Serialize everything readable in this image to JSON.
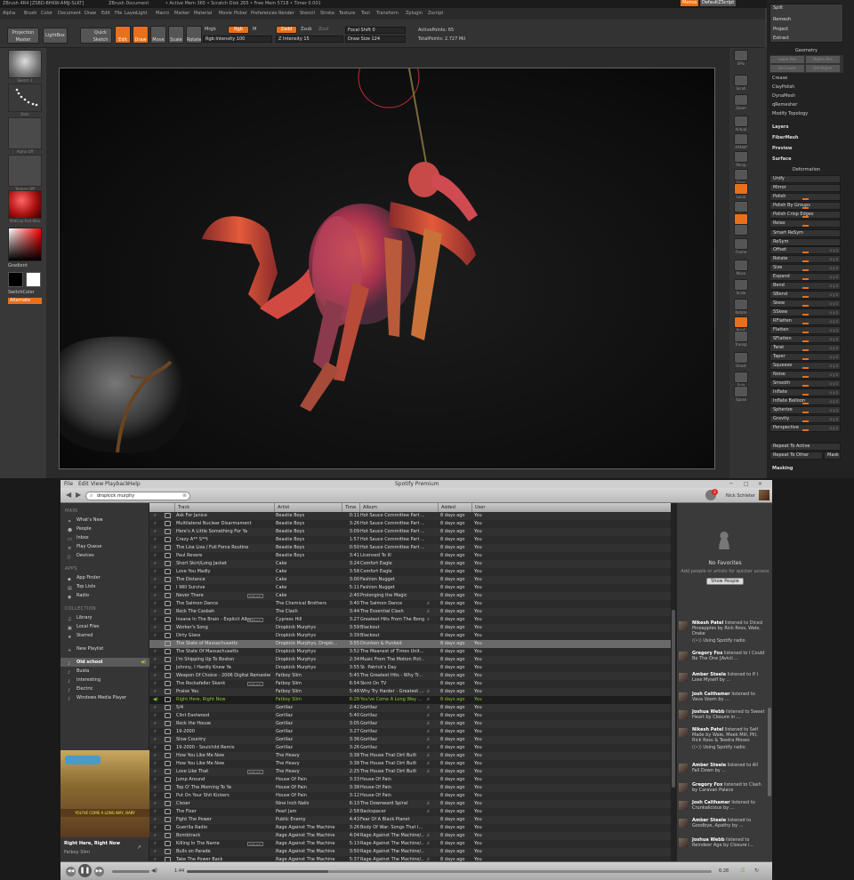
{
  "zbrush": {
    "title_left": "ZBrush 4R4 [ZSBD-BHKW-AMJJ-SLKT]",
    "title_doc": "ZBrush Document",
    "title_stats": "• Active Mem 365 • Scratch Disk 265 • Free Mem 5718 • Timer 0.001",
    "menus_button": "Menus",
    "default_script": "DefaultZScript",
    "menu": [
      "Alpha",
      "Brush",
      "Color",
      "Document",
      "Draw",
      "Edit",
      "File",
      "Layer",
      "Light",
      "Macro",
      "Marker",
      "Material",
      "Movie",
      "Picker",
      "Preferences",
      "Render",
      "Stencil",
      "Stroke",
      "Texture",
      "Tool",
      "Transform",
      "Zplugin",
      "Zscript"
    ],
    "toolbar": {
      "projection_master": "Projection Master",
      "lightbox": "LightBox",
      "quick_sketch": "Quick Sketch",
      "edit": "Edit",
      "draw": "Draw",
      "move": "Move",
      "scale": "Scale",
      "rotate": "Rotate",
      "mrgb": "Mrgb",
      "rgb": "Rgb",
      "m": "M",
      "rgb_intensity": "Rgb Intensity 100",
      "zadd": "Zadd",
      "zsub": "Zsub",
      "zcut": "Zcut",
      "z_intensity": "Z Intensity 15",
      "focal_shift": "Focal Shift 0",
      "draw_size": "Draw Size 124",
      "active_points": "ActivePoints: 65",
      "total_points": "TotalPoints: 2.727 Mil"
    },
    "left": {
      "tile1_label": "Sketch 1",
      "tile2_label": "Dots",
      "tile3_label": "Alpha Off",
      "tile4_label": "Texture Off",
      "tile5_label": "MatCap Red Wax",
      "gradient": "Gradient",
      "switch_color": "SwitchColor",
      "alternate": "Alternate"
    },
    "right_icons": [
      {
        "label": "SPix",
        "icon": "spix-icon"
      },
      {
        "label": "Scroll",
        "icon": "scroll-icon"
      },
      {
        "label": "Zoom",
        "icon": "zoom-icon"
      },
      {
        "label": "Actual",
        "icon": "actual-icon"
      },
      {
        "label": "AAHalf",
        "icon": "aahalf-icon"
      },
      {
        "label": "Persp",
        "icon": "persp-icon"
      },
      {
        "label": "Floor",
        "icon": "floor-icon"
      },
      {
        "label": "Local",
        "icon": "local-icon"
      },
      {
        "label": "L.Sym",
        "icon": "lsym-icon"
      },
      {
        "label": "Xyz",
        "icon": "xyz-icon"
      },
      {
        "label": "",
        "icon": "rotate-axis-icon"
      },
      {
        "label": "Frame",
        "icon": "frame-icon"
      },
      {
        "label": "Move",
        "icon": "move-icon"
      },
      {
        "label": "Scale",
        "icon": "scale-icon"
      },
      {
        "label": "Rotate",
        "icon": "rotate-icon"
      },
      {
        "label": "PolyF",
        "icon": "polyf-icon"
      },
      {
        "label": "Transp",
        "icon": "transp-icon"
      },
      {
        "label": "Ghost",
        "icon": "ghost-icon"
      },
      {
        "label": "Solo",
        "icon": "solo-icon"
      },
      {
        "label": "Xpose",
        "icon": "xpose-icon"
      }
    ],
    "panel": {
      "top_items": [
        "Split",
        "Remesh",
        "Project",
        "Extract"
      ],
      "geometry": "Geometry",
      "geo_buttons": [
        "Lower Res",
        "Higher Res",
        "Del Lower",
        "Del Higher"
      ],
      "geo_items": [
        "Crease",
        "ClayPolish",
        "DynaMesh",
        "qRemesher",
        "Modify Topology"
      ],
      "layers": "Layers",
      "fibermesh": "FiberMesh",
      "preview": "Preview",
      "surface": "Surface",
      "deformation": "Deformation",
      "unify": "Unify",
      "mirror": "Mirror",
      "polish": "Polish",
      "polish_groups": "Polish By Groups",
      "polish_crisp": "Polish Crisp Edges",
      "relax": "Relax",
      "smart_resym": "Smart ReSym",
      "resym": "ReSym",
      "sliders": [
        "Offset",
        "Rotate",
        "Size",
        "Expand",
        "Bend",
        "SBend",
        "Skew",
        "SSkew",
        "RFlatten",
        "Flatten",
        "SFlatten",
        "Twist",
        "Taper",
        "Squeeze",
        "Noise",
        "Smooth",
        "Inflate",
        "Inflate Balloon",
        "Spherize",
        "Gravity",
        "Perspective"
      ],
      "xyz": "x y z",
      "repeat_active": "Repeat To Active",
      "repeat_other": "Repeat To Other",
      "mask": "Mask",
      "masking": "Masking"
    }
  },
  "spotify": {
    "title": "Spotify Premium",
    "menu": [
      "File",
      "Edit",
      "View",
      "Playback",
      "Help"
    ],
    "search": "dropkick murphy",
    "notifications": "2",
    "user": "Nick Schleter",
    "sidebar": {
      "main_head": "MAIN",
      "main": [
        "What's New",
        "People",
        "Inbox",
        "Play Queue",
        "Devices"
      ],
      "apps_head": "APPS",
      "apps": [
        "App Finder",
        "Top Lists",
        "Radio"
      ],
      "collection_head": "COLLECTION",
      "collection": [
        "Library",
        "Local Files",
        "Starred"
      ],
      "new_playlist": "New Playlist",
      "playlists": [
        "Old school",
        "Busta",
        "Interesting",
        "Electric",
        "Windows Media Player"
      ],
      "now_title": "Right Here, Right Now",
      "now_artist": "Fatboy Slim",
      "cover_text": "YOU'VE COME A LONG WAY, BABY"
    },
    "columns": [
      "Track",
      "Artist",
      "Time",
      "Album",
      "Added",
      "User"
    ],
    "tracks": [
      {
        "t": "Ask For Janice",
        "a": "Beastie Boys",
        "d": "0:11",
        "al": "Hot Sauce Committee Part ...",
        "ad": "8 days ago",
        "u": "You"
      },
      {
        "t": "Multilateral Nuclear Disarmament",
        "a": "Beastie Boys",
        "d": "3:26",
        "al": "Hot Sauce Committee Part ...",
        "ad": "8 days ago",
        "u": "You"
      },
      {
        "t": "Here's A Little Something For Ya",
        "a": "Beastie Boys",
        "d": "3:09",
        "al": "Hot Sauce Committee Part ...",
        "ad": "8 days ago",
        "u": "You"
      },
      {
        "t": "Crazy A** S**t",
        "a": "Beastie Boys",
        "d": "1:57",
        "al": "Hot Sauce Committee Part ...",
        "ad": "8 days ago",
        "u": "You"
      },
      {
        "t": "The Lisa Lisa / Full Force Routine",
        "a": "Beastie Boys",
        "d": "0:50",
        "al": "Hot Sauce Committee Part ...",
        "ad": "8 days ago",
        "u": "You"
      },
      {
        "t": "Paul Revere",
        "a": "Beastie Boys",
        "d": "3:41",
        "al": "Licensed To Ill",
        "ad": "8 days ago",
        "u": "You"
      },
      {
        "t": "Short Skirt/Long Jacket",
        "a": "Cake",
        "d": "3:24",
        "al": "Comfort Eagle",
        "ad": "8 days ago",
        "u": "You"
      },
      {
        "t": "Love You Madly",
        "a": "Cake",
        "d": "3:58",
        "al": "Comfort Eagle",
        "ad": "8 days ago",
        "u": "You"
      },
      {
        "t": "The Distance",
        "a": "Cake",
        "d": "3:00",
        "al": "Fashion Nugget",
        "ad": "8 days ago",
        "u": "You"
      },
      {
        "t": "I Will Survive",
        "a": "Cake",
        "d": "5:11",
        "al": "Fashion Nugget",
        "ad": "8 days ago",
        "u": "You"
      },
      {
        "t": "Never There",
        "a": "Cake",
        "d": "2:40",
        "al": "Prolonging the Magic",
        "ad": "8 days ago",
        "u": "You",
        "tag": "EXPLICIT"
      },
      {
        "t": "The Salmon Dance",
        "a": "The Chemical Brothers",
        "d": "3:40",
        "al": "The Salmon Dance",
        "ad": "8 days ago",
        "u": "You",
        "lnk": "true"
      },
      {
        "t": "Rock The Casbah",
        "a": "The Clash",
        "d": "3:44",
        "al": "The Essential Clash",
        "ad": "8 days ago",
        "u": "You",
        "lnk": "true"
      },
      {
        "t": "Insane In The Brain - Explicit Albu...",
        "a": "Cypress Hill",
        "d": "3:27",
        "al": "Greatest Hits From The Bong",
        "ad": "8 days ago",
        "u": "You",
        "tag": "EXPLICIT",
        "lnk": "true"
      },
      {
        "t": "Worker's Song",
        "a": "Dropkick Murphys",
        "d": "3:59",
        "al": "Blackout",
        "ad": "8 days ago",
        "u": "You"
      },
      {
        "t": "Dirty Glass",
        "a": "Dropkick Murphys",
        "d": "3:39",
        "al": "Blackout",
        "ad": "8 days ago",
        "u": "You"
      },
      {
        "t": "The State of Massachusetts",
        "a": "Dropkick Murphys, Dropki...",
        "d": "3:55",
        "al": "Drunken & Punked",
        "ad": "8 days ago",
        "u": "You",
        "sel": "true"
      },
      {
        "t": "The State Of Massachusetts",
        "a": "Dropkick Murphys",
        "d": "3:52",
        "al": "The Meanest of Times Unit...",
        "ad": "8 days ago",
        "u": "You"
      },
      {
        "t": "I'm Shipping Up To Boston",
        "a": "Dropkick Murphys",
        "d": "2:34",
        "al": "Music From The Motion Pict...",
        "ad": "8 days ago",
        "u": "You"
      },
      {
        "t": "Johnny, I Hardly Knew Ya",
        "a": "Dropkick Murphys",
        "d": "3:55",
        "al": "St. Patrick's Day",
        "ad": "8 days ago",
        "u": "You"
      },
      {
        "t": "Weapon Of Choice - 2006 Digital Remaster",
        "a": "Fatboy Slim",
        "d": "5:45",
        "al": "The Greatest Hits - Why Tr...",
        "ad": "8 days ago",
        "u": "You"
      },
      {
        "t": "The Rockafeller Skank",
        "a": "Fatboy Slim",
        "d": "6:54",
        "al": "Skint On TV",
        "ad": "8 days ago",
        "u": "You",
        "tag": "EXPLICIT"
      },
      {
        "t": "Praise You",
        "a": "Fatboy Slim",
        "d": "5:48",
        "al": "Why Try Harder - Greatest ...",
        "ad": "8 days ago",
        "u": "You",
        "lnk": "true"
      },
      {
        "t": "Right Here, Right Now",
        "a": "Fatboy Slim",
        "d": "6:28",
        "al": "You've Come A Long Way ...",
        "ad": "8 days ago",
        "u": "You",
        "lnk": "true",
        "playing": "true"
      },
      {
        "t": "5/4",
        "a": "Gorillaz",
        "d": "2:42",
        "al": "Gorillaz",
        "ad": "8 days ago",
        "u": "You",
        "lnk": "true"
      },
      {
        "t": "Clint Eastwood",
        "a": "Gorillaz",
        "d": "5:40",
        "al": "Gorillaz",
        "ad": "8 days ago",
        "u": "You",
        "lnk": "true"
      },
      {
        "t": "Rock the House",
        "a": "Gorillaz",
        "d": "3:05",
        "al": "Gorillaz",
        "ad": "8 days ago",
        "u": "You",
        "lnk": "true"
      },
      {
        "t": "19-2000",
        "a": "Gorillaz",
        "d": "3:27",
        "al": "Gorillaz",
        "ad": "8 days ago",
        "u": "You",
        "lnk": "true"
      },
      {
        "t": "Slow Country",
        "a": "Gorillaz",
        "d": "3:36",
        "al": "Gorillaz",
        "ad": "8 days ago",
        "u": "You",
        "lnk": "true"
      },
      {
        "t": "19-2000 - Soulchild Remix",
        "a": "Gorillaz",
        "d": "3:26",
        "al": "Gorillaz",
        "ad": "8 days ago",
        "u": "You",
        "lnk": "true"
      },
      {
        "t": "How You Like Me Now",
        "a": "The Heavy",
        "d": "3:38",
        "al": "The House That Dirt Built",
        "ad": "8 days ago",
        "u": "You",
        "lnk": "true"
      },
      {
        "t": "How You Like Me Now",
        "a": "The Heavy",
        "d": "3:38",
        "al": "The House That Dirt Built",
        "ad": "8 days ago",
        "u": "You",
        "lnk": "true"
      },
      {
        "t": "Love Like That",
        "a": "The Heavy",
        "d": "2:25",
        "al": "The House That Dirt Built",
        "ad": "8 days ago",
        "u": "You",
        "tag": "EXPLICIT",
        "lnk": "true"
      },
      {
        "t": "Jump Around",
        "a": "House Of Pain",
        "d": "3:33",
        "al": "House Of Pain",
        "ad": "8 days ago",
        "u": "You"
      },
      {
        "t": "Top O' The Morning To Ya",
        "a": "House Of Pain",
        "d": "3:38",
        "al": "House Of Pain",
        "ad": "8 days ago",
        "u": "You"
      },
      {
        "t": "Put On Your Shit Kickers",
        "a": "House Of Pain",
        "d": "3:12",
        "al": "House Of Pain",
        "ad": "8 days ago",
        "u": "You"
      },
      {
        "t": "Closer",
        "a": "Nine Inch Nails",
        "d": "6:13",
        "al": "The Downward Spiral",
        "ad": "8 days ago",
        "u": "You",
        "lnk": "true"
      },
      {
        "t": "The Fixer",
        "a": "Pearl Jam",
        "d": "2:58",
        "al": "Backspacer",
        "ad": "8 days ago",
        "u": "You",
        "lnk": "true"
      },
      {
        "t": "Fight The Power",
        "a": "Public Enemy",
        "d": "4:43",
        "al": "Fear Of A Black Planet",
        "ad": "8 days ago",
        "u": "You"
      },
      {
        "t": "Guerilla Radio",
        "a": "Rage Against The Machine",
        "d": "3:26",
        "al": "Body Of War: Songs That I...",
        "ad": "8 days ago",
        "u": "You"
      },
      {
        "t": "Bombtrack",
        "a": "Rage Against The Machine",
        "d": "4:04",
        "al": "Rage Against The Machine/...",
        "ad": "8 days ago",
        "u": "You",
        "lnk": "true"
      },
      {
        "t": "Killing In The Name",
        "a": "Rage Against The Machine",
        "d": "5:13",
        "al": "Rage Against The Machine/...",
        "ad": "8 days ago",
        "u": "You",
        "tag": "EXPLICIT",
        "lnk": "true"
      },
      {
        "t": "Bulls on Parade",
        "a": "Rage Against The Machine",
        "d": "3:50",
        "al": "Rage Against The Machine/...",
        "ad": "8 days ago",
        "u": "You"
      },
      {
        "t": "Take The Power Back",
        "a": "Rage Against The Machine",
        "d": "5:37",
        "al": "Rage Against The Machine/...",
        "ad": "8 days ago",
        "u": "You",
        "lnk": "true"
      }
    ],
    "right": {
      "no_favorites": "No Favorites",
      "add_people": "Add people or artists for quicker access",
      "show_people": "Show People",
      "feed": [
        {
          "name": "Nikesh Patel",
          "text": " listened to Diced Pineapples by Rick Ross, Wale, Drake",
          "extra": "Using Spotify radio"
        },
        {
          "name": "Gregory Fox",
          "text": " listened to I Could Be The One [Avicii ...",
          "extra": ""
        },
        {
          "name": "Amber Steele",
          "text": " listened to If I Lose Myself by ...",
          "extra": ""
        },
        {
          "name": "Josh Caithamer",
          "text": " listened to Vava Voom by ...",
          "extra": ""
        },
        {
          "name": "Joshua Webb",
          "text": " listened to Sweet Heart by Closure in ...",
          "extra": ""
        },
        {
          "name": "Nikesh Patel",
          "text": " listened to Self Made by Wale, Meek Mill, Pill, Rick Ross & Teedra Moses",
          "extra": "Using Spotify radio"
        },
        {
          "name": "Amber Steele",
          "text": " listened to All Fall Down by ...",
          "extra": ""
        },
        {
          "name": "Gregory Fox",
          "text": " listened to Clash by Caravan Palace",
          "extra": ""
        },
        {
          "name": "Josh Caithamer",
          "text": " listened to Crunkalicious by ...",
          "extra": ""
        },
        {
          "name": "Amber Steele",
          "text": " listened to Goodbye, Apathy by ...",
          "extra": ""
        },
        {
          "name": "Joshua Webb",
          "text": " listened to Reindeer Age by Closure i...",
          "extra": ""
        }
      ]
    },
    "player": {
      "elapsed": "1:44",
      "total": "6:28",
      "progress": 0.27
    }
  }
}
